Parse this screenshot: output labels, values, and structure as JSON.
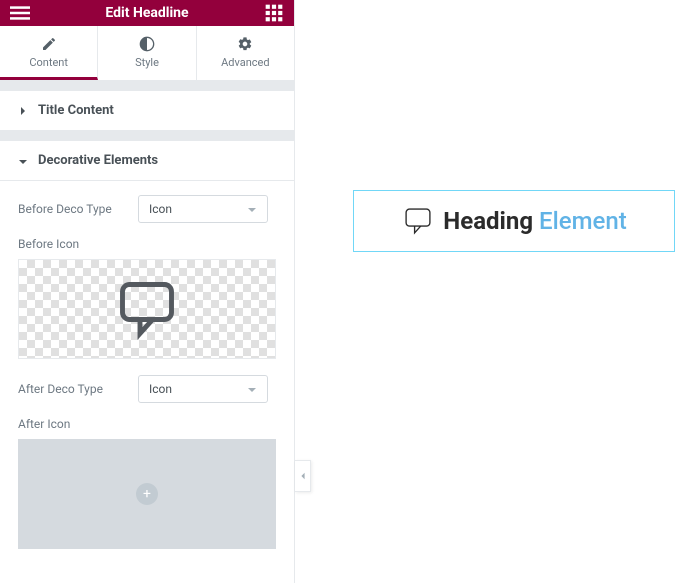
{
  "header": {
    "title": "Edit Headline"
  },
  "tabs": {
    "content": "Content",
    "style": "Style",
    "advanced": "Advanced"
  },
  "sections": {
    "title_content": {
      "label": "Title Content"
    },
    "decorative": {
      "label": "Decorative Elements",
      "before_type_label": "Before Deco Type",
      "before_type_value": "Icon",
      "before_icon_label": "Before Icon",
      "after_type_label": "After Deco Type",
      "after_type_value": "Icon",
      "after_icon_label": "After Icon"
    }
  },
  "preview": {
    "heading_main": "Heading",
    "heading_accent": "Element"
  }
}
